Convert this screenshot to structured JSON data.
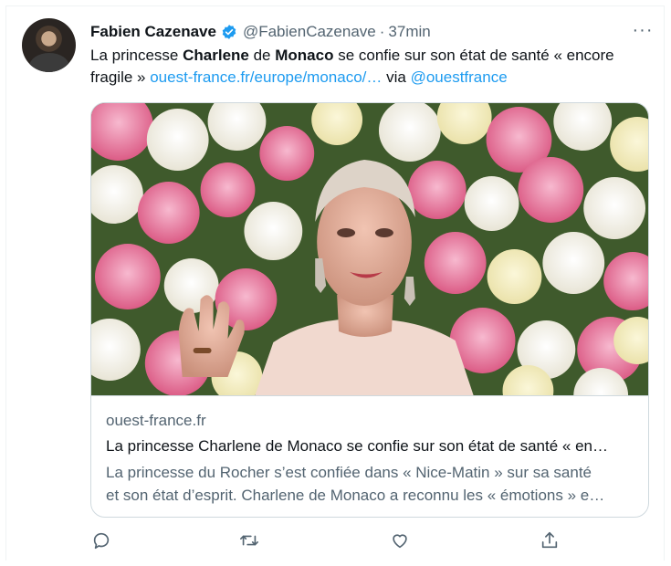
{
  "tweet": {
    "author_name": "Fabien Cazenave",
    "handle": "@FabienCazenave",
    "separator": "·",
    "time": "37min",
    "more_label": "···",
    "text_1": "La princesse ",
    "text_bold_1": "Charlene",
    "text_2": " de ",
    "text_bold_2": "Monaco",
    "text_3": " se confie sur son état de santé « encore fragile » ",
    "link_text": "ouest-france.fr/europe/monaco/…",
    "text_4": " via ",
    "mention": "@ouestfrance"
  },
  "card": {
    "domain": "ouest-france.fr",
    "title": "La princesse Charlene de Monaco se confie sur son état de santé « en…",
    "description_line1": "La princesse du Rocher s’est confiée dans « Nice-Matin » sur sa santé",
    "description_line2": "et son état d’esprit. Charlene de Monaco a reconnu les « émotions » e…"
  },
  "icons": {
    "reply": "reply-icon",
    "retweet": "retweet-icon",
    "like": "heart-icon",
    "share": "share-icon",
    "verified": "verified-badge-icon"
  },
  "colors": {
    "link": "#1d9bf0",
    "secondary_text": "#536471",
    "border": "#cfd9de",
    "verified": "#1d9bf0"
  }
}
